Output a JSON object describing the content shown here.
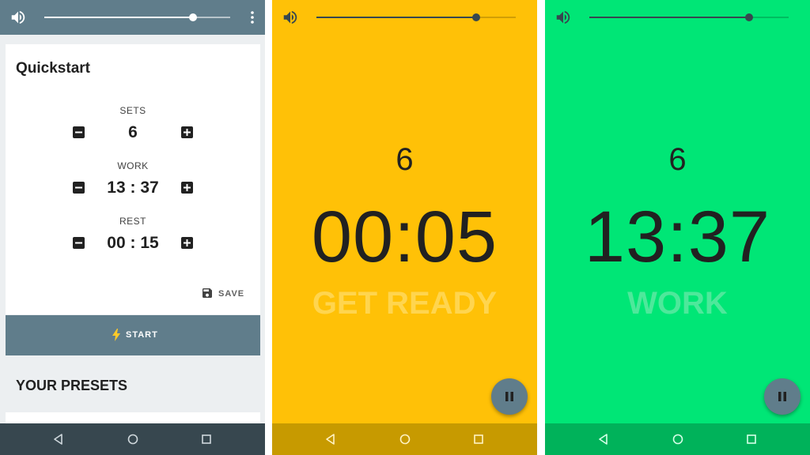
{
  "colors": {
    "setup_background": "#eceff1",
    "setup_topbar": "#607d8b",
    "get_ready_background": "#ffc107",
    "work_background": "#00e676",
    "accent": "#607d8b"
  },
  "volume": {
    "icon": "volume-icon",
    "level": 0.8
  },
  "quickstart": {
    "title": "Quickstart",
    "sets": {
      "label": "SETS",
      "value": "6"
    },
    "work": {
      "label": "WORK",
      "value": "13 : 37"
    },
    "rest": {
      "label": "REST",
      "value": "00 : 15"
    },
    "save_label": "SAVE",
    "start_label": "START"
  },
  "presets": {
    "title": "YOUR PRESETS"
  },
  "get_ready_screen": {
    "sets": "6",
    "time": "00:05",
    "phase": "GET READY"
  },
  "work_screen": {
    "sets": "6",
    "time": "13:37",
    "phase": "WORK"
  },
  "navigation": [
    "back-icon",
    "home-icon",
    "recents-icon"
  ]
}
